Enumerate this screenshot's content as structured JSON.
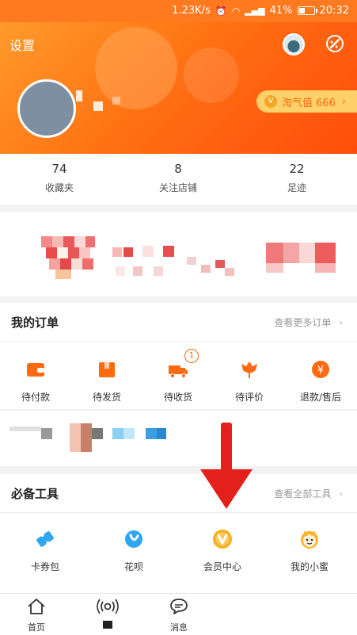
{
  "status_bar": {
    "speed": "1.23K/s",
    "battery": "41%",
    "battery_level": 0.41,
    "time": "20:32"
  },
  "header": {
    "settings_label": "设置",
    "taoqizhi_label": "淘气值 666"
  },
  "stats": [
    {
      "count": "74",
      "label": "收藏夹"
    },
    {
      "count": "8",
      "label": "关注店铺"
    },
    {
      "count": "22",
      "label": "足迹"
    }
  ],
  "orders": {
    "title": "我的订单",
    "more": "查看更多订单",
    "items": [
      {
        "label": "待付款",
        "icon": "wallet-icon"
      },
      {
        "label": "待发货",
        "icon": "box-icon"
      },
      {
        "label": "待收货",
        "icon": "truck-icon",
        "badge": "1"
      },
      {
        "label": "待评价",
        "icon": "flower-icon"
      },
      {
        "label": "退款/售后",
        "icon": "refund-icon"
      }
    ]
  },
  "tools": {
    "title": "必备工具",
    "more": "查看全部工具",
    "items": [
      {
        "label": "卡券包",
        "icon": "ticket-icon"
      },
      {
        "label": "花呗",
        "icon": "huabei-icon"
      },
      {
        "label": "会员中心",
        "icon": "vip-icon"
      },
      {
        "label": "我的小蜜",
        "icon": "assistant-icon"
      }
    ]
  },
  "tabbar": [
    {
      "label": "首页",
      "icon": "home-icon"
    },
    {
      "label": "",
      "icon": "live-icon"
    },
    {
      "label": "消息",
      "icon": "message-icon"
    }
  ],
  "colors": {
    "brand_orange": "#ff6a10",
    "arrow_red": "#e3201b"
  }
}
